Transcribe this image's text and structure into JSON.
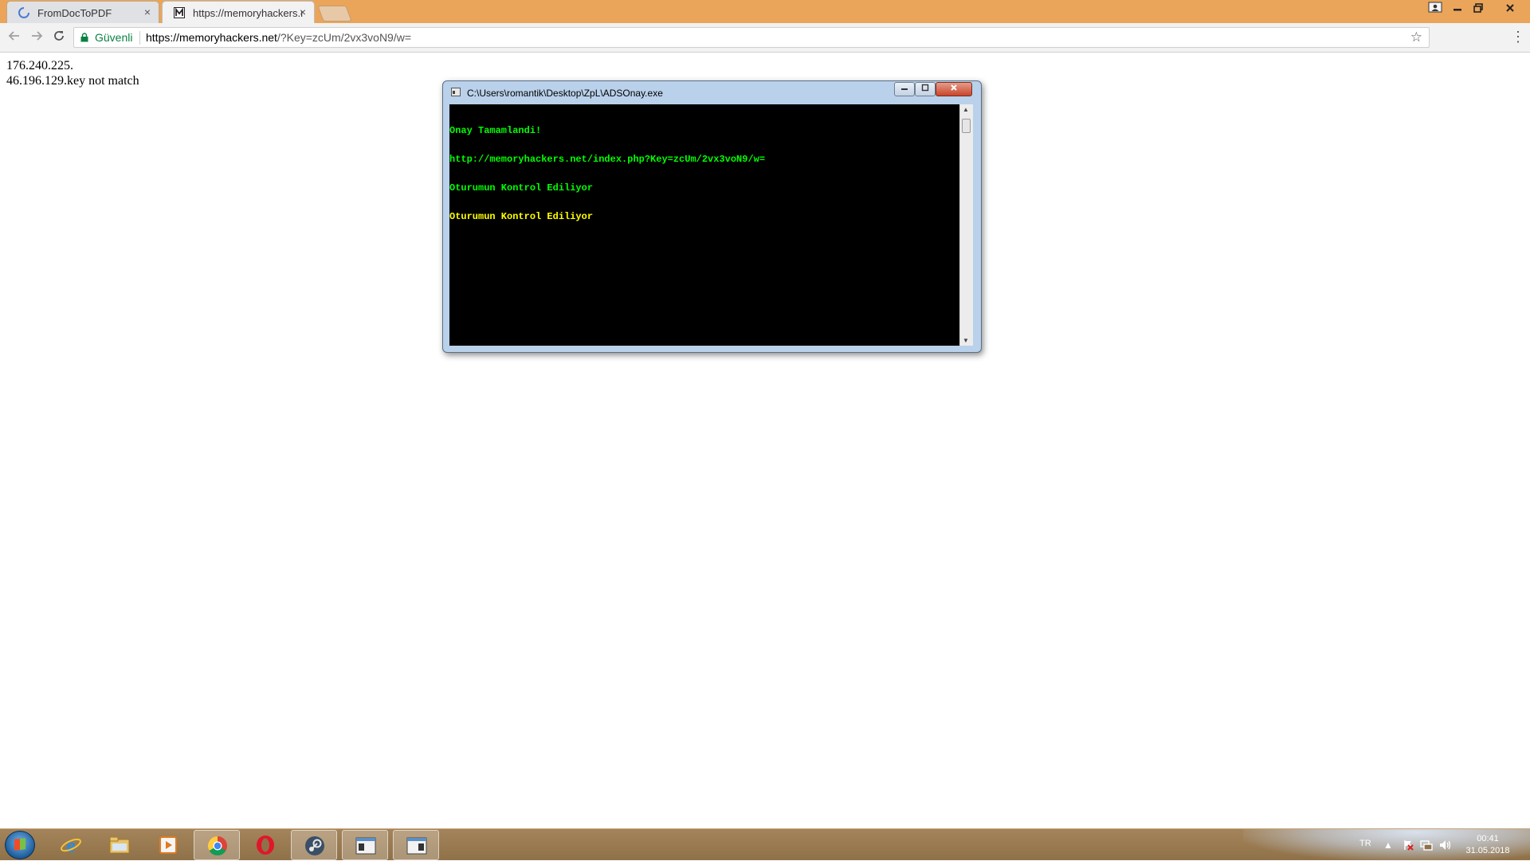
{
  "browser": {
    "tabs": [
      {
        "title": "FromDocToPDF",
        "close": "×"
      },
      {
        "title": "https://memoryhackers.n",
        "close": "×"
      }
    ],
    "secure_label": "Güvenli",
    "url_host": "https://memoryhackers.net",
    "url_path": "/?Key=zcUm/2vx3voN9/w="
  },
  "page": {
    "line1": "176.240.225.",
    "line2": "46.196.129.key not match"
  },
  "console": {
    "title": "C:\\Users\\romantik\\Desktop\\ZpL\\ADSOnay.exe",
    "lines": [
      {
        "text": "Onay Tamamlandi!",
        "color": "#00ff00"
      },
      {
        "text": "http://memoryhackers.net/index.php?Key=zcUm/2vx3voN9/w=",
        "color": "#00ff00"
      },
      {
        "text": "Oturumun Kontrol Ediliyor",
        "color": "#00ff00"
      },
      {
        "text": "Oturumun Kontrol Ediliyor",
        "color": "#ffff00"
      }
    ]
  },
  "taskbar": {
    "apps": [
      "internet-explorer",
      "file-explorer",
      "media-player",
      "chrome",
      "opera",
      "steam",
      "console-app",
      "console-app-2"
    ],
    "language": "TR",
    "clock_time": "00:41",
    "clock_date": "31.05.2018"
  },
  "colors": {
    "tabstrip": "#eaa55a",
    "taskbar": "#8f7149",
    "console_bg": "#000000",
    "console_green": "#00ff00",
    "console_yellow": "#ffff00",
    "secure_green": "#0b8043"
  }
}
